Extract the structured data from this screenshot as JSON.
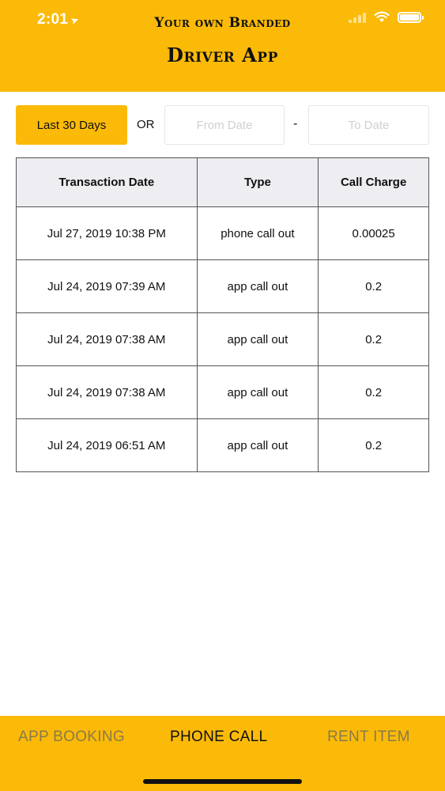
{
  "status_bar": {
    "time": "2:01",
    "location_icon": "location-arrow-icon",
    "signal_icon": "cellular-signal-icon",
    "wifi_icon": "wifi-icon",
    "battery_icon": "battery-icon"
  },
  "header": {
    "line1": "Your own Branded",
    "line2": "Driver App",
    "background_color": "#FBBA07"
  },
  "filters": {
    "range_button_label": "Last 30 Days",
    "or_label": "OR",
    "from_date_placeholder": "From Date",
    "separator": "-",
    "to_date_placeholder": "To Date"
  },
  "table": {
    "columns": [
      "Transaction Date",
      "Type",
      "Call Charge"
    ],
    "rows": [
      {
        "date": "Jul 27, 2019 10:38 PM",
        "type": "phone call out",
        "charge": "0.00025"
      },
      {
        "date": "Jul 24, 2019 07:39 AM",
        "type": "app call out",
        "charge": "0.2"
      },
      {
        "date": "Jul 24, 2019 07:38 AM",
        "type": "app call out",
        "charge": "0.2"
      },
      {
        "date": "Jul 24, 2019 07:38 AM",
        "type": "app call out",
        "charge": "0.2"
      },
      {
        "date": "Jul 24, 2019 06:51 AM",
        "type": "app call out",
        "charge": "0.2"
      }
    ]
  },
  "tabbar": {
    "tabs": [
      {
        "label": "APP BOOKING",
        "active": false
      },
      {
        "label": "PHONE CALL",
        "active": true
      },
      {
        "label": "RENT ITEM",
        "active": false
      }
    ]
  }
}
